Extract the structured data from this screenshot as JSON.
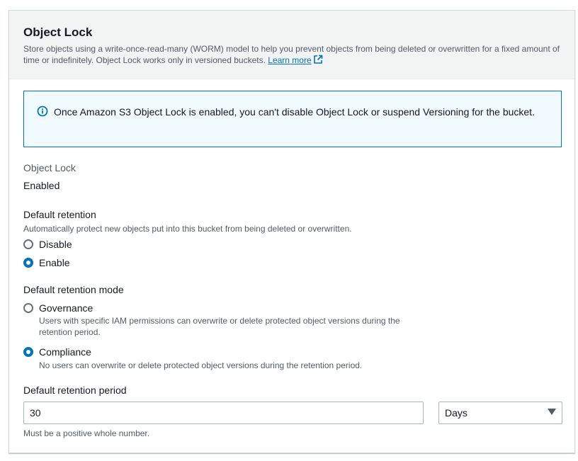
{
  "header": {
    "title": "Object Lock",
    "description": "Store objects using a write-once-read-many (WORM) model to help you prevent objects from being deleted or overwritten for a fixed amount of time or indefinitely. Object Lock works only in versioned buckets.",
    "learn_more": "Learn more"
  },
  "alert": {
    "text": "Once Amazon S3 Object Lock is enabled, you can't disable Object Lock or suspend Versioning for the bucket.",
    "icon": "info-icon"
  },
  "object_lock": {
    "label": "Object Lock",
    "value": "Enabled"
  },
  "default_retention": {
    "label": "Default retention",
    "description": "Automatically protect new objects put into this bucket from being deleted or overwritten.",
    "options": [
      {
        "label": "Disable",
        "selected": false
      },
      {
        "label": "Enable",
        "selected": true
      }
    ]
  },
  "retention_mode": {
    "label": "Default retention mode",
    "options": [
      {
        "label": "Governance",
        "description": "Users with specific IAM permissions can overwrite or delete protected object versions during the retention period.",
        "selected": false
      },
      {
        "label": "Compliance",
        "description": "No users can overwrite or delete protected object versions during the retention period.",
        "selected": true
      }
    ]
  },
  "retention_period": {
    "label": "Default retention period",
    "value": "30",
    "unit": "Days",
    "hint": "Must be a positive whole number."
  },
  "colors": {
    "accent": "#0073bb",
    "alert_bg": "#f1faff",
    "header_bg": "#f2f3f3"
  }
}
